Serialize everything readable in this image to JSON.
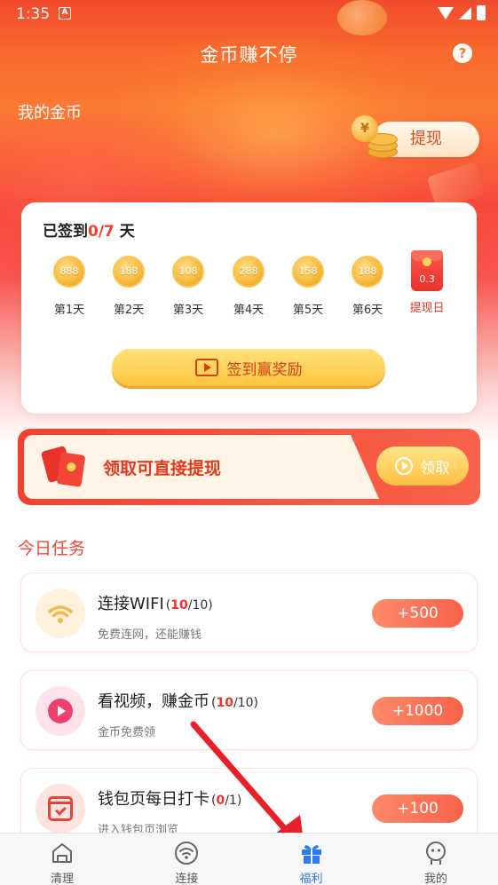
{
  "status_bar": {
    "time": "1:35",
    "notification_icon": "A"
  },
  "header": {
    "title": "金币赚不停",
    "help": "?"
  },
  "coins": {
    "label": "我的金币",
    "withdraw_label": "提现",
    "coin_symbol": "¥"
  },
  "checkin": {
    "title_prefix": "已签到",
    "progress_done": "0",
    "progress_total": "/7",
    "title_suffix": " 天",
    "days": [
      {
        "amount": "888",
        "label": "第1天"
      },
      {
        "amount": "188",
        "label": "第2天"
      },
      {
        "amount": "108",
        "label": "第3天"
      },
      {
        "amount": "288",
        "label": "第4天"
      },
      {
        "amount": "158",
        "label": "第5天"
      },
      {
        "amount": "188",
        "label": "第6天"
      }
    ],
    "final_day": {
      "amount": "0.3",
      "label": "提现日"
    },
    "button_label": "签到赢奖励"
  },
  "banner": {
    "text": "领取可直接提现",
    "button_label": "领取"
  },
  "tasks_section": {
    "title": "今日任务"
  },
  "tasks": [
    {
      "title": "连接WIFI",
      "progress_open": "(",
      "done": "10",
      "total": "/10)",
      "subtitle": "免费连网，还能赚钱",
      "reward": "+500",
      "icon": "wifi-icon"
    },
    {
      "title": "看视频，赚金币",
      "progress_open": "(",
      "done": "10",
      "total": "/10)",
      "subtitle": "金币免费领",
      "reward": "+1000",
      "icon": "play-icon"
    },
    {
      "title": "钱包页每日打卡",
      "progress_open": "(",
      "done": "0",
      "total": "/1)",
      "subtitle": "进入钱包页浏览",
      "reward": "+100",
      "icon": "calendar-check-icon"
    }
  ],
  "bottom_nav": [
    {
      "label": "清理",
      "icon": "broom-icon",
      "active": false
    },
    {
      "label": "连接",
      "icon": "wifi-icon",
      "active": false
    },
    {
      "label": "福利",
      "icon": "gift-icon",
      "active": true
    },
    {
      "label": "我的",
      "icon": "profile-icon",
      "active": false
    }
  ],
  "colors": {
    "accent": "#f2402d",
    "nav_active": "#2c7bf0",
    "button_gold": "#ffc53d"
  }
}
